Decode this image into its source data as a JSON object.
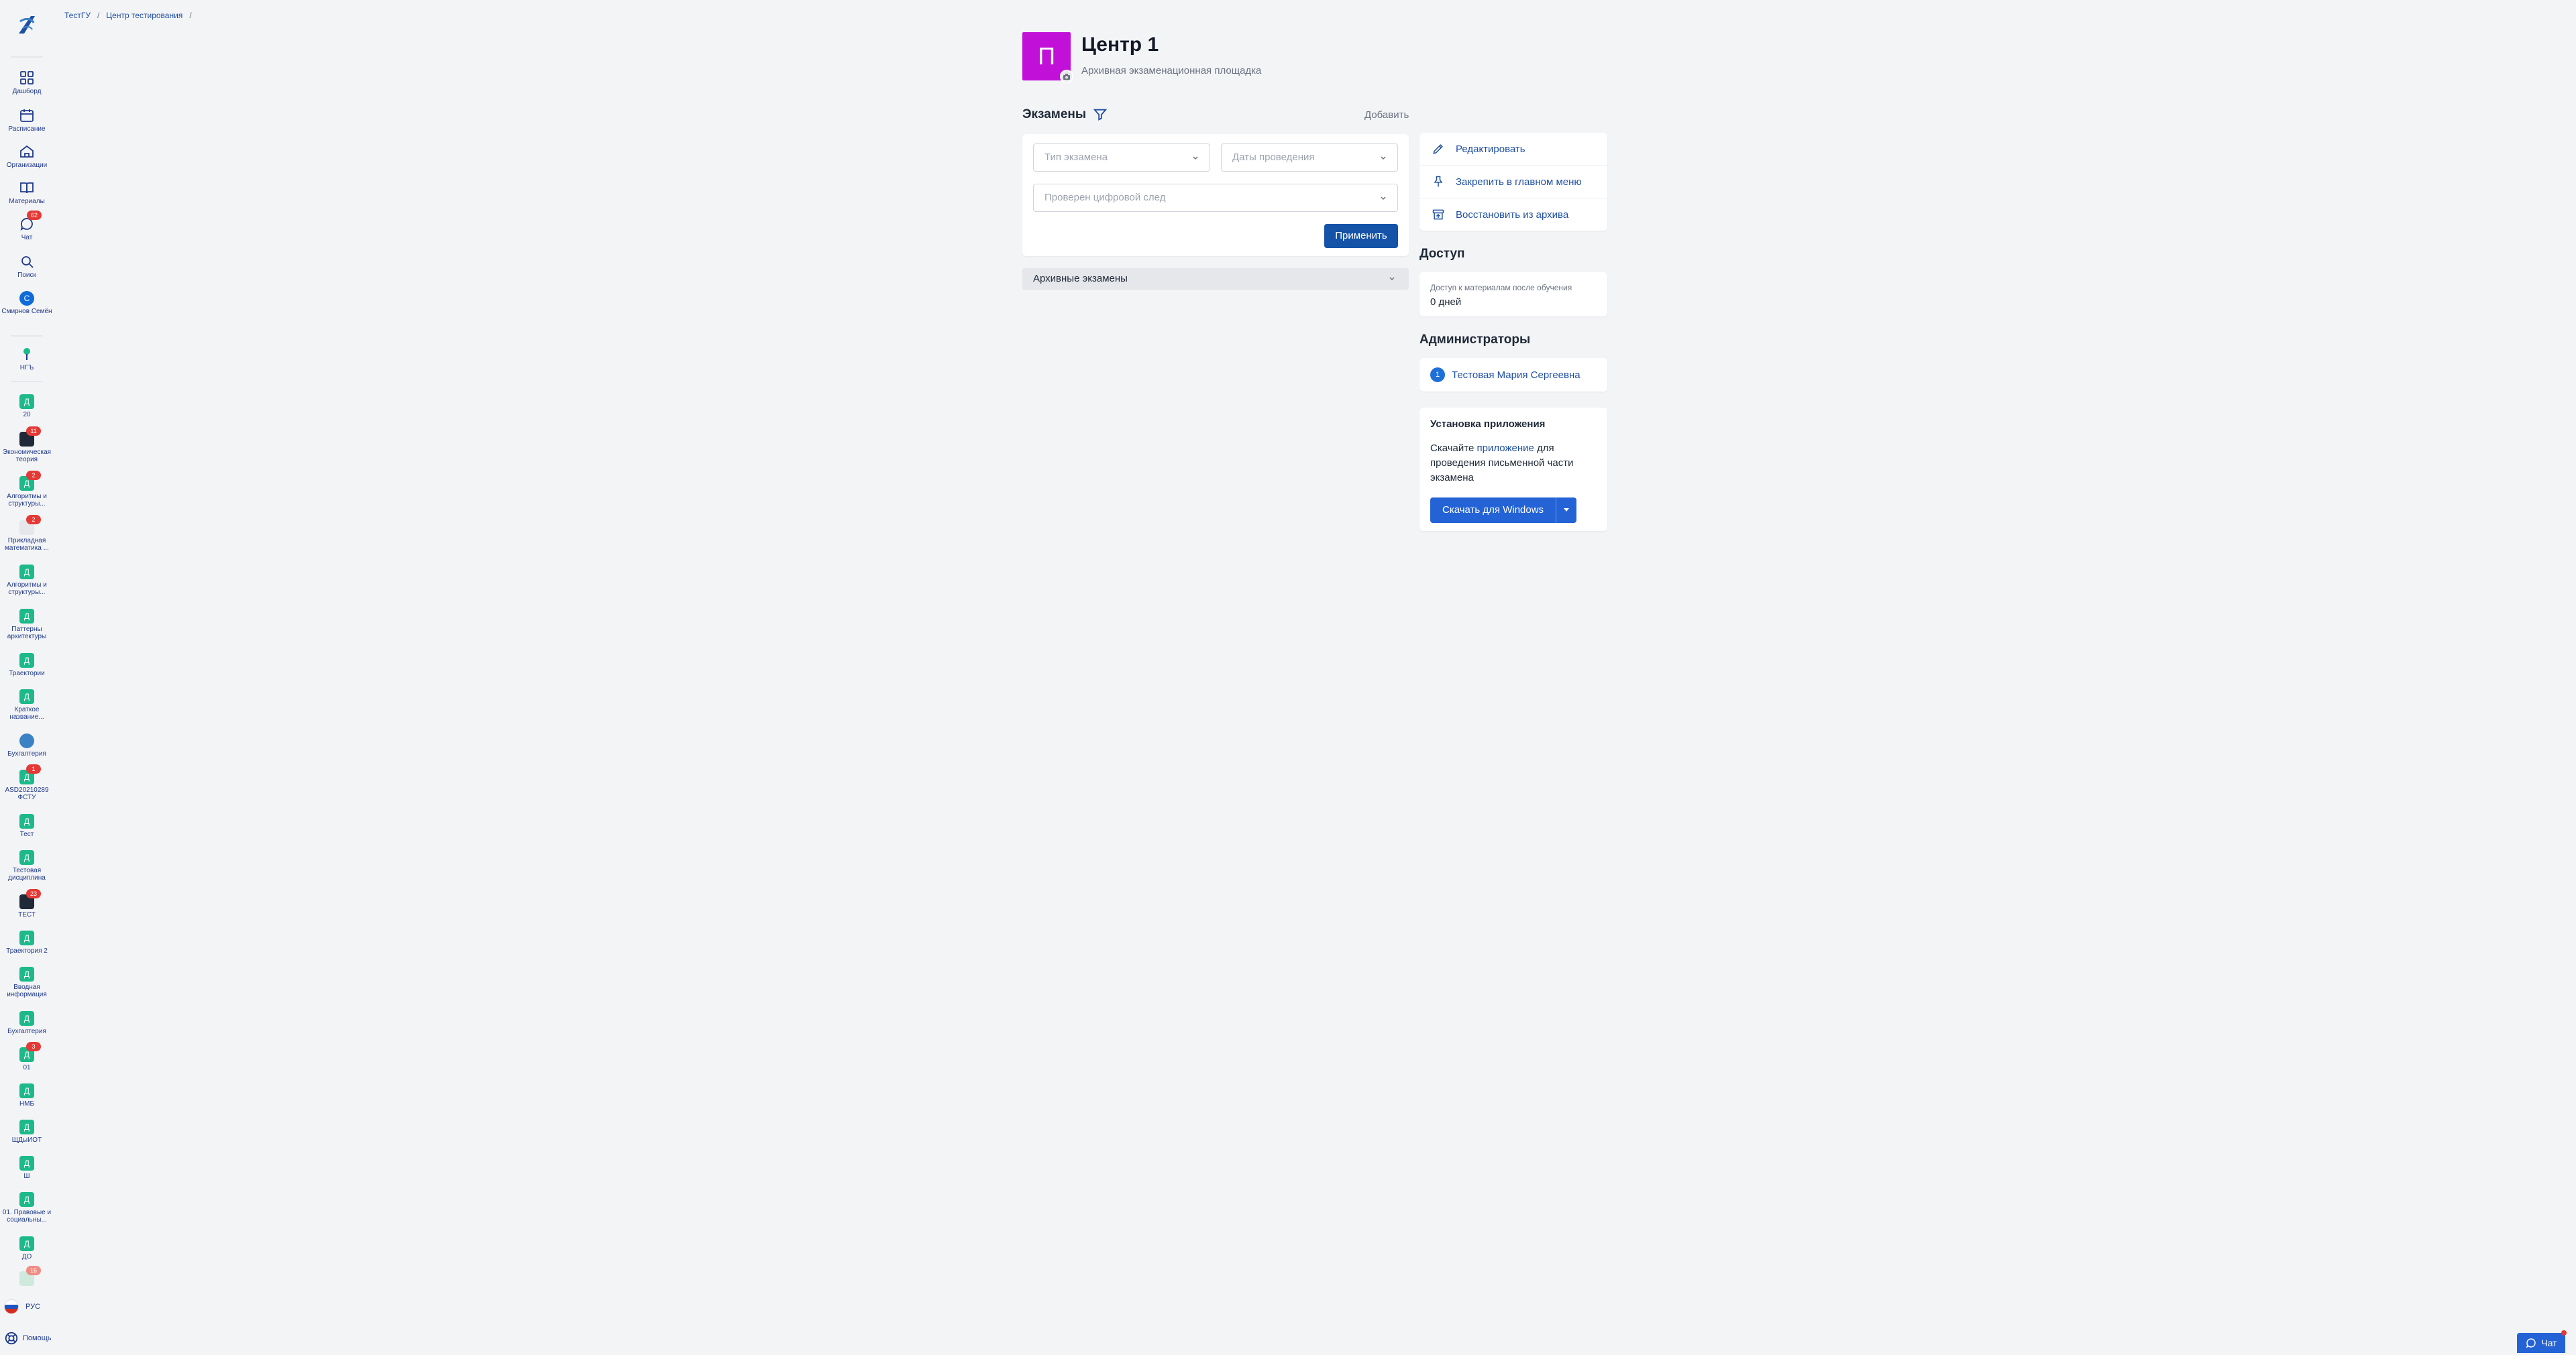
{
  "breadcrumb": [
    "ТестГУ",
    "Центр тестирования"
  ],
  "sidebar": {
    "main": [
      {
        "label": "Дашборд",
        "icon": "dashboard-icon"
      },
      {
        "label": "Расписание",
        "icon": "calendar-icon"
      },
      {
        "label": "Организации",
        "icon": "building-icon"
      },
      {
        "label": "Материалы",
        "icon": "book-icon"
      },
      {
        "label": "Чат",
        "icon": "chat-icon",
        "badge": "62"
      },
      {
        "label": "Поиск",
        "icon": "search-icon"
      },
      {
        "label": "Смирнов Семён",
        "icon": "user-avatar-icon",
        "avatar": "С"
      },
      {
        "label": "НГЪ",
        "icon": "tree-icon"
      }
    ],
    "courses": [
      {
        "label": "20",
        "avatar": "Д"
      },
      {
        "label": "Экономическая теория",
        "avatar": "",
        "badge": "11"
      },
      {
        "label": "Алгоритмы и структуры...",
        "avatar": "Д",
        "badge": "2"
      },
      {
        "label": "Прикладная математика ...",
        "avatar": "",
        "badge": "2"
      },
      {
        "label": "Алгоритмы и структуры...",
        "avatar": "Д"
      },
      {
        "label": "Паттерны архитектуры",
        "avatar": "Д"
      },
      {
        "label": "Траектории",
        "avatar": "Д"
      },
      {
        "label": "Краткое название...",
        "avatar": "Д"
      },
      {
        "label": "Бухгалтерия",
        "avatar": ""
      },
      {
        "label": "АSD20210289 ФСТУ",
        "avatar": "Д",
        "badge": "1"
      },
      {
        "label": "Тест",
        "avatar": "Д"
      },
      {
        "label": "Тестовая дисциплина",
        "avatar": "Д"
      },
      {
        "label": "ТЕСТ",
        "avatar": "",
        "badge": "23"
      },
      {
        "label": "Траектория 2",
        "avatar": "Д"
      },
      {
        "label": "Вводная информация",
        "avatar": "Д"
      },
      {
        "label": "Бухгалтерия",
        "avatar": "Д"
      },
      {
        "label": "01",
        "avatar": "Д",
        "badge": "3"
      },
      {
        "label": "НМБ",
        "avatar": "Д"
      },
      {
        "label": "ЩДыИОТ",
        "avatar": "Д"
      },
      {
        "label": "Ш",
        "avatar": "Д"
      },
      {
        "label": "01. Правовые и социальны...",
        "avatar": "Д"
      },
      {
        "label": "ДО",
        "avatar": "Д"
      },
      {
        "label": "",
        "avatar": "",
        "badge": "16"
      }
    ],
    "language": "РУС",
    "help": "Помощь"
  },
  "header": {
    "avatar_letter": "П",
    "title": "Центр 1",
    "subtitle": "Архивная экзаменационная площадка"
  },
  "exams": {
    "title": "Экзамены",
    "add_label": "Добавить",
    "filter_type_placeholder": "Тип экзамена",
    "filter_dates_placeholder": "Даты проведения",
    "filter_trace_placeholder": "Проверен цифровой след",
    "apply_label": "Применить",
    "archived_label": "Архивные экзамены"
  },
  "actions": [
    {
      "label": "Редактировать",
      "icon": "pencil-icon"
    },
    {
      "label": "Закрепить в главном меню",
      "icon": "pin-icon"
    },
    {
      "label": "Восстановить из архива",
      "icon": "archive-restore-icon"
    }
  ],
  "access": {
    "title": "Доступ",
    "caption": "Доступ к материалам после обучения",
    "value": "0 дней"
  },
  "admins": {
    "title": "Администраторы",
    "items": [
      {
        "num": "1",
        "name": "Тестовая Мария Сергеевна"
      }
    ]
  },
  "install": {
    "title": "Установка приложения",
    "text_before": "Скачайте",
    "link": "приложение",
    "text_after": "для проведения письменной части экзамена",
    "button_label": "Скачать для Windows"
  },
  "chat_fab": {
    "label": "Чат"
  },
  "colors": {
    "accent": "#1553a9",
    "org_avatar": "#c110d8",
    "course_avatar": "#1db98a",
    "badge": "#e53935"
  }
}
